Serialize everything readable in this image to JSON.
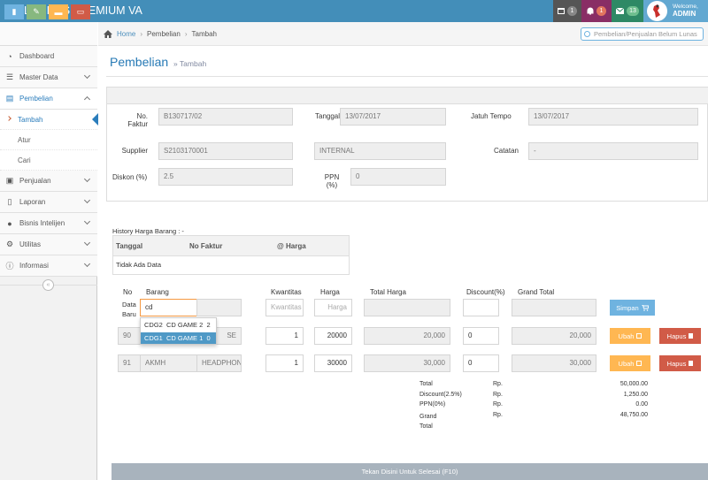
{
  "app": {
    "brand": "LEMPOS PREMIUM VA"
  },
  "topbar": {
    "messages_count": "1",
    "notifications_count": "1",
    "mail_count": "13",
    "welcome": "Welcome,",
    "user": "ADMIN"
  },
  "sidebar": {
    "items": [
      {
        "label": "Dashboard",
        "icon": "dashboard-icon"
      },
      {
        "label": "Master Data",
        "icon": "database-icon"
      },
      {
        "label": "Pembelian",
        "icon": "cart-icon"
      },
      {
        "label": "Penjualan",
        "icon": "money-icon"
      },
      {
        "label": "Laporan",
        "icon": "file-icon"
      },
      {
        "label": "Bisnis Intelijen",
        "icon": "user-icon"
      },
      {
        "label": "Utilitas",
        "icon": "cogs-icon"
      },
      {
        "label": "Informasi",
        "icon": "info-icon"
      }
    ],
    "sub": [
      {
        "label": "Tambah"
      },
      {
        "label": "Atur"
      },
      {
        "label": "Cari"
      }
    ],
    "collapse": "«"
  },
  "breadcrumb": {
    "home": "Home",
    "section": "Pembelian",
    "page": "Tambah"
  },
  "search": {
    "placeholder": "Pembelian/Penjualan Belum Lunas"
  },
  "page": {
    "title": "Pembelian",
    "subtitle": "» Tambah"
  },
  "form": {
    "no_faktur_label1": "No.",
    "no_faktur_label2": "Faktur",
    "no_faktur": "B130717/02",
    "tanggal_label": "Tanggal",
    "tanggal": "13/07/2017",
    "jatuh_tempo_label": "Jatuh Tempo",
    "jatuh_tempo": "13/07/2017",
    "supplier_label": "Supplier",
    "supplier_code": "S2103170001",
    "supplier_name": "INTERNAL",
    "catatan_label": "Catatan",
    "catatan": "-",
    "diskon_label": "Diskon (%)",
    "diskon": "2.5",
    "ppn_label1": "PPN",
    "ppn_label2": "(%)",
    "ppn": "0"
  },
  "history": {
    "title": "History Harga Barang : -",
    "headers": [
      "Tanggal",
      "No Faktur",
      "@ Harga"
    ],
    "empty": "Tidak Ada Data"
  },
  "items_table": {
    "headers": {
      "no": "No",
      "barang": "Barang",
      "kwantitas": "Kwantitas",
      "harga": "Harga",
      "total": "Total Harga",
      "discount": "Discount(%)",
      "grand": "Grand Total"
    },
    "new_row": {
      "label1": "Data",
      "label2": "Baru",
      "barang_value": "cd",
      "kwantitas_placeholder": "Kwantitas",
      "harga_placeholder": "Harga",
      "save": "Simpan"
    },
    "rows": [
      {
        "no": "90",
        "name_tail": "SE",
        "qty": "1",
        "harga": "20000",
        "total": "20,000",
        "disc": "0",
        "grand": "20,000"
      },
      {
        "no": "91",
        "code": "AKMH",
        "name": "HEADPHON",
        "qty": "1",
        "harga": "30000",
        "total": "30,000",
        "disc": "0",
        "grand": "30,000"
      }
    ],
    "edit": "Ubah",
    "delete": "Hapus"
  },
  "autocomplete": [
    {
      "code": "CDG2",
      "name": "CD GAME 2",
      "stock": "2"
    },
    {
      "code": "CDG1",
      "name": "CD GAME 1",
      "stock": "0"
    }
  ],
  "totals": {
    "rows": [
      {
        "label": "Total",
        "cur": "Rp.",
        "value": "50,000.00"
      },
      {
        "label": "Discount(2.5%)",
        "cur": "Rp.",
        "value": "1,250.00"
      },
      {
        "label": "PPN(0%)",
        "cur": "Rp.",
        "value": "0.00"
      },
      {
        "label": "Grand",
        "cur": "Rp.",
        "value": "48,750.00"
      }
    ],
    "grand_second": "Total"
  },
  "footer": {
    "finish": "Tekan Disini Untuk Selesai (F10)"
  }
}
